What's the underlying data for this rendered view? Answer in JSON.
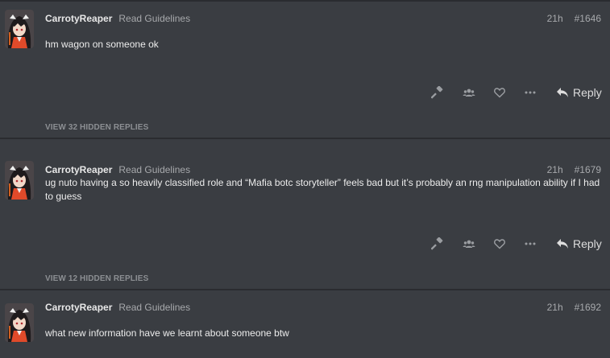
{
  "posts": [
    {
      "username": "CarrotyReaper",
      "title": "Read Guidelines",
      "time": "21h",
      "post_number": "#1646",
      "body": "hm wagon on someone ok",
      "reply_label": "Reply",
      "hidden_replies": "VIEW 32 HIDDEN REPLIES"
    },
    {
      "username": "CarrotyReaper",
      "title": "Read Guidelines",
      "time": "21h",
      "post_number": "#1679",
      "body": "ug nuto having a so heavily classified role and “Mafia botc storyteller” feels bad but it’s probably an rng manipulation ability if I had to guess",
      "reply_label": "Reply",
      "hidden_replies": "VIEW 12 HIDDEN REPLIES"
    },
    {
      "username": "CarrotyReaper",
      "title": "Read Guidelines",
      "time": "21h",
      "post_number": "#1692",
      "body": "what new information have we learnt about someone btw"
    }
  ],
  "icons": {
    "vote": "gavel-icon",
    "players": "users-icon",
    "like": "heart-icon",
    "more": "ellipsis-icon",
    "reply": "reply-arrow-icon"
  },
  "colors": {
    "background": "#3a3d42",
    "divider": "#2a2c30",
    "text": "#ececec",
    "muted": "#a7a9ac",
    "hidden_replies": "#8c8f93"
  }
}
